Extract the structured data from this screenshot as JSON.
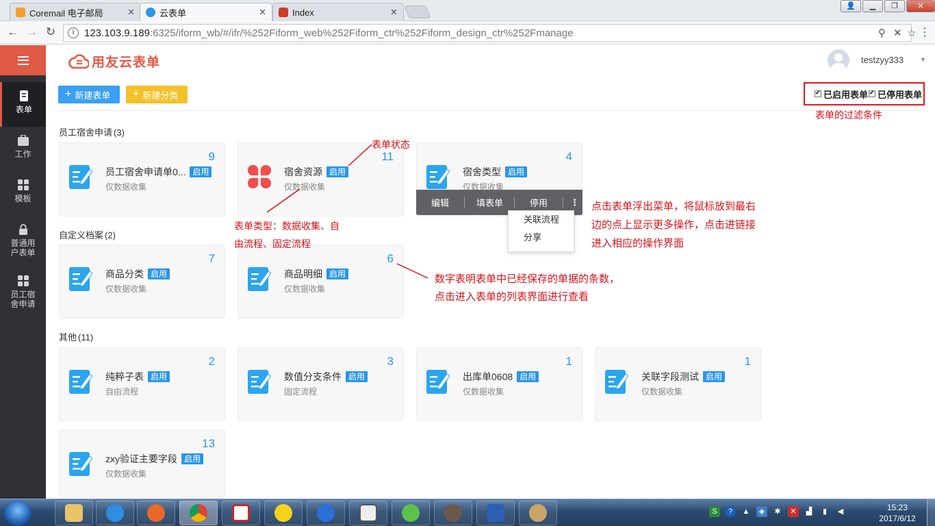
{
  "browser": {
    "tabs": [
      {
        "title": "Coremail 电子邮局",
        "favicon_color": "#f0a030"
      },
      {
        "title": "云表单",
        "favicon_color": "#2a96e8"
      },
      {
        "title": "Index",
        "favicon_color": "#d03a2a"
      }
    ],
    "url_host": "123.103.9.189",
    "url_path": ":6325/iform_wb/#/ifr/%252Fiform_web%252Fiform_ctr%252Fiform_design_ctr%252Fmanage"
  },
  "sidebar": {
    "items": [
      {
        "label": "表单",
        "icon": "form-icon"
      },
      {
        "label": "工作",
        "icon": "briefcase-icon"
      },
      {
        "label": "模板",
        "icon": "template-icon"
      },
      {
        "label": "普通用户表单",
        "icon": "lock-icon"
      },
      {
        "label": "员工宿舍申请",
        "icon": "apps-icon"
      }
    ]
  },
  "header": {
    "logo_text": "用友云表单",
    "username": "testzyy333"
  },
  "toolbar": {
    "new_form_label": "新建表单",
    "new_category_label": "新建分类"
  },
  "filter": {
    "enabled_label": "已启用表单",
    "disabled_label": "已停用表单",
    "enabled_checked": true,
    "disabled_checked": true
  },
  "groups": [
    {
      "name": "员工宿舍申请",
      "count": "(3)",
      "cards": [
        {
          "title": "员工宿舍申请单0...",
          "badge": "启用",
          "type": "仅数据收集",
          "count": "9",
          "icon": "form-edit-icon"
        },
        {
          "title": "宿舍资源",
          "badge": "启用",
          "type": "仅数据收集",
          "count": "11",
          "icon": "clover-icon"
        },
        {
          "title": "宿舍类型",
          "badge": "启用",
          "type": "仅数据收集",
          "count": "4",
          "icon": "form-edit-icon"
        }
      ]
    },
    {
      "name": "自定义档案",
      "count": "(2)",
      "cards": [
        {
          "title": "商品分类",
          "badge": "启用",
          "type": "仅数据收集",
          "count": "7",
          "icon": "form-edit-icon"
        },
        {
          "title": "商品明细",
          "badge": "启用",
          "type": "仅数据收集",
          "count": "6",
          "icon": "form-edit-icon"
        }
      ]
    },
    {
      "name": "其他",
      "count": "(11)",
      "cards": [
        {
          "title": "纯粹子表",
          "badge": "启用",
          "type": "自由流程",
          "count": "2",
          "icon": "form-edit-icon"
        },
        {
          "title": "数值分支条件",
          "badge": "启用",
          "type": "固定流程",
          "count": "3",
          "icon": "form-edit-icon"
        },
        {
          "title": "出库单0608",
          "badge": "启用",
          "type": "仅数据收集",
          "count": "1",
          "icon": "form-edit-icon"
        },
        {
          "title": "关联字段测试",
          "badge": "启用",
          "type": "仅数据收集",
          "count": "1",
          "icon": "form-edit-icon"
        },
        {
          "title": "zxy验证主要字段",
          "badge": "启用",
          "type": "仅数据收集",
          "count": "13",
          "icon": "form-edit-icon"
        }
      ]
    }
  ],
  "card_menu": {
    "edit": "编辑",
    "fill": "填表单",
    "disable": "停用",
    "more": "⋮",
    "dropdown": [
      "关联流程",
      "分享"
    ]
  },
  "annotations": {
    "filter_note": "表单的过滤条件",
    "status_note": "表单状态",
    "type_note_1": "表单类型：数据收集、自",
    "type_note_2": "由流程、固定流程",
    "menu_note_1": "点击表单浮出菜单，将鼠标放到最右",
    "menu_note_2": "边的点上显示更多操作，点击进链接",
    "menu_note_3": "进入相应的操作界面",
    "count_note_1": "数字表明表单中已经保存的单据的条数，",
    "count_note_2": "点击进入表单的列表界面进行查看",
    "color": "#d7121a"
  },
  "taskbar": {
    "time": "15:23",
    "date": "2017/6/12"
  },
  "colors": {
    "accent_red": "#e05a46",
    "badge_blue": "#2a96e8",
    "button_yellow": "#f5c12b",
    "sidebar_bg": "#2f3136"
  }
}
